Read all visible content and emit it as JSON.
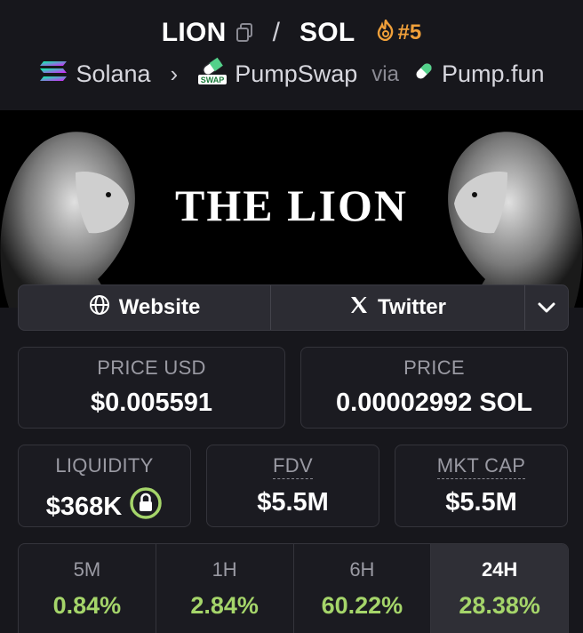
{
  "header": {
    "base_symbol": "LION",
    "separator": "/",
    "quote_symbol": "SOL",
    "trending_rank": "#5",
    "chain": "Solana",
    "dex": "PumpSwap",
    "via_label": "via",
    "launchpad": "Pump.fun",
    "dex_icon_text": "SWAP"
  },
  "banner": {
    "title": "THE LION"
  },
  "links": {
    "website": "Website",
    "twitter": "Twitter"
  },
  "stats": {
    "price_usd": {
      "label": "PRICE USD",
      "value": "$0.005591"
    },
    "price": {
      "label": "PRICE",
      "value": "0.00002992 SOL"
    },
    "liquidity": {
      "label": "LIQUIDITY",
      "value": "$368K"
    },
    "fdv": {
      "label": "FDV",
      "value": "$5.5M"
    },
    "mkt_cap": {
      "label": "MKT CAP",
      "value": "$5.5M"
    }
  },
  "changes": [
    {
      "period": "5M",
      "pct": "0.84%"
    },
    {
      "period": "1H",
      "pct": "2.84%"
    },
    {
      "period": "6H",
      "pct": "60.22%"
    },
    {
      "period": "24H",
      "pct": "28.38%"
    }
  ],
  "colors": {
    "positive": "#a5d56a",
    "trending": "#f0a03a",
    "background": "#17171c"
  }
}
